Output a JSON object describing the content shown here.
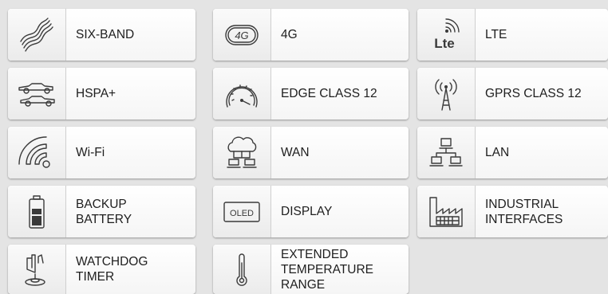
{
  "tiles": [
    {
      "label": "SIX-BAND",
      "icon": "six-band-icon"
    },
    {
      "label": "4G",
      "icon": "4g-icon",
      "icon_text": "4G"
    },
    {
      "label": "LTE",
      "icon": "lte-icon",
      "icon_text": "Lte"
    },
    {
      "label": "HSPA+",
      "icon": "hspa-icon"
    },
    {
      "label": "EDGE CLASS 12",
      "icon": "speedometer-icon"
    },
    {
      "label": "GPRS CLASS 12",
      "icon": "antenna-tower-icon"
    },
    {
      "label": "Wi-Fi",
      "icon": "wifi-icon"
    },
    {
      "label": "WAN",
      "icon": "wan-cloud-icon"
    },
    {
      "label": "LAN",
      "icon": "lan-network-icon"
    },
    {
      "label": "BACKUP\nBATTERY",
      "icon": "battery-icon"
    },
    {
      "label": "DISPLAY",
      "icon": "oled-display-icon",
      "icon_text": "OLED"
    },
    {
      "label": "INDUSTRIAL\nINTERFACES",
      "icon": "factory-icon"
    },
    {
      "label": "WATCHDOG\nTIMER",
      "icon": "watchdog-hand-icon"
    },
    {
      "label": "EXTENDED\nTEMPERATURE\nRANGE",
      "icon": "thermometer-icon"
    }
  ]
}
